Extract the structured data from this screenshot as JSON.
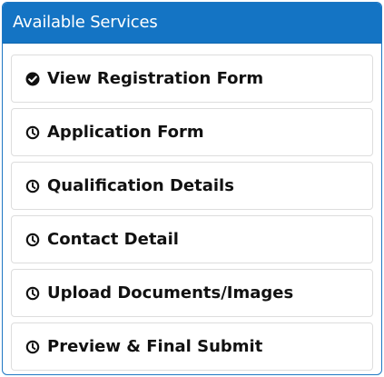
{
  "panel": {
    "title": "Available Services"
  },
  "services": {
    "items": [
      {
        "label": "View Registration Form",
        "icon": "check-circle-icon",
        "status": "completed"
      },
      {
        "label": "Application Form",
        "icon": "clock-icon",
        "status": "pending"
      },
      {
        "label": "Qualification Details",
        "icon": "clock-icon",
        "status": "pending"
      },
      {
        "label": "Contact Detail",
        "icon": "clock-icon",
        "status": "pending"
      },
      {
        "label": "Upload Documents/Images",
        "icon": "clock-icon",
        "status": "pending"
      },
      {
        "label": "Preview & Final Submit",
        "icon": "clock-icon",
        "status": "pending"
      }
    ]
  },
  "colors": {
    "header_bg": "#1474c4",
    "border": "#dddddd",
    "text": "#111111"
  }
}
